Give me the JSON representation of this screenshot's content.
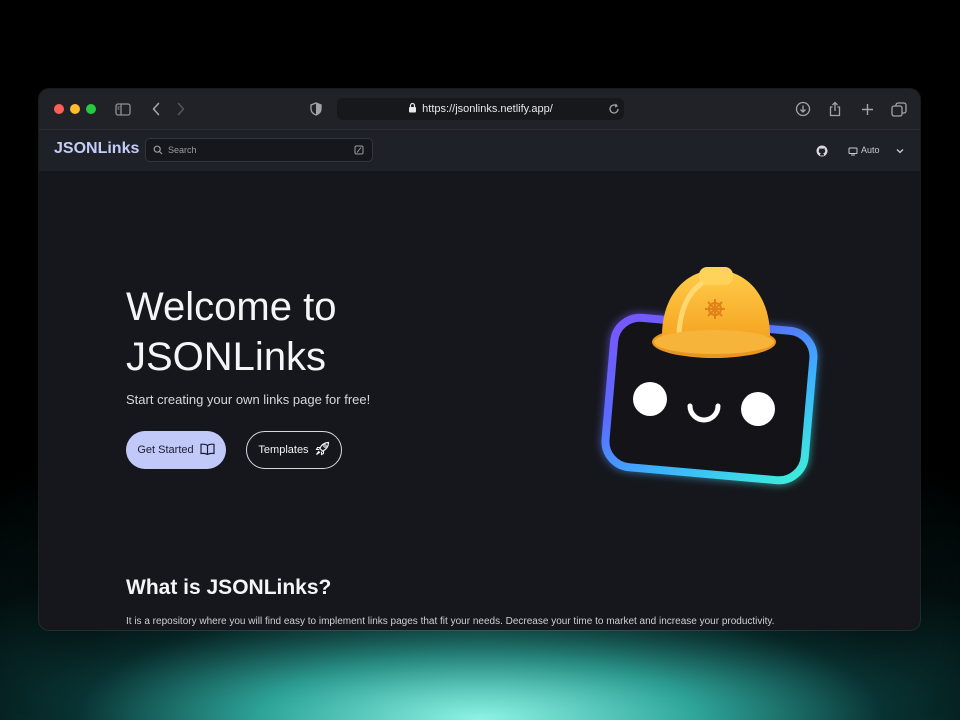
{
  "browser": {
    "url": "https://jsonlinks.netlify.app/"
  },
  "header": {
    "logo": "JSONLinks",
    "search_placeholder": "Search",
    "theme_label": "Auto"
  },
  "hero": {
    "title_line1": "Welcome to",
    "title_line2": "JSONLinks",
    "subtitle": "Start creating your own links page for free!",
    "primary_button": "Get Started",
    "secondary_button": "Templates"
  },
  "section": {
    "title": "What is JSONLinks?",
    "text": "It is a repository where you will find easy to implement links pages that fit your needs. Decrease your time to market and increase your productivity."
  },
  "colors": {
    "accent": "#c1c9f9",
    "page_background": "#16171c",
    "header_background": "#1f2129",
    "glow": "#5fe6d8"
  },
  "icons": [
    "sidebar-icon",
    "back-icon",
    "forward-icon",
    "shield-icon",
    "lock-icon",
    "reload-icon",
    "download-icon",
    "share-icon",
    "new-tab-icon",
    "tabs-overview-icon",
    "search-icon",
    "keyboard-shortcut-icon",
    "github-icon",
    "monitor-icon",
    "chevron-down-icon",
    "book-icon",
    "rocket-icon"
  ]
}
